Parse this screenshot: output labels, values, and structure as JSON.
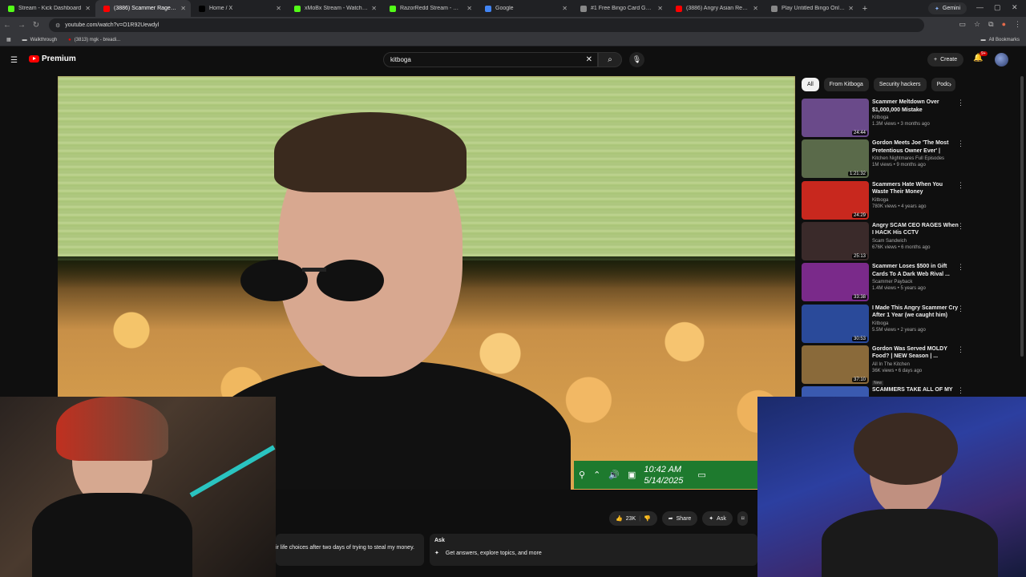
{
  "browser": {
    "tabs": [
      {
        "label": "Stream - Kick Dashboard",
        "color": "#53fc18"
      },
      {
        "label": "(3886) Scammer Rages Lo...",
        "color": "#ff0000"
      },
      {
        "label": "Home / X",
        "color": "#000000"
      },
      {
        "label": "xMoBx Stream - Watch Live on",
        "color": "#53fc18"
      },
      {
        "label": "RazorRedd Stream - Watch Live",
        "color": "#53fc18"
      },
      {
        "label": "Google",
        "color": "#4285f4"
      },
      {
        "label": "#1 Free Bingo Card Generator",
        "color": "#888888"
      },
      {
        "label": "(3886) Angry Asian Restaurant",
        "color": "#ff0000"
      },
      {
        "label": "Play Untitled Bingo Online | Bi",
        "color": "#888888"
      }
    ],
    "gemini_label": "Gemini",
    "url": "youtube.com/watch?v=O1R92Uewdyl",
    "bookmarks": [
      {
        "label": "Walkthrough"
      },
      {
        "label": "(3813) mgk - breadi..."
      }
    ],
    "all_bookmarks": "All Bookmarks"
  },
  "youtube": {
    "logo_text": "Premium",
    "search_value": "kitboga",
    "create_label": "Create",
    "notif_badge": "9+",
    "chips": [
      "All",
      "From Kitboga",
      "Security hackers",
      "Podc"
    ],
    "likes": "23K",
    "share_label": "Share",
    "ask_label": "Ask",
    "description_snippet": "ir life choices after two days of trying to steal my money.",
    "ask_title": "Ask",
    "ask_prompt": "Get answers, explore topics, and more",
    "recommendations": [
      {
        "title": "Scammer Meltdown Over $1,000,000 Mistake",
        "channel": "Kitboga",
        "meta": "1.3M views • 3 months ago",
        "duration": "24:44",
        "thumb_color": "#6a4a8a"
      },
      {
        "title": "Gordon Meets Joe 'The Most Pretentious Owner Ever' | FULL...",
        "channel": "Kitchen Nightmares Full Episodes",
        "meta": "1M views • 9 months ago",
        "duration": "1:21:32",
        "thumb_color": "#5a6a4a"
      },
      {
        "title": "Scammers Hate When You Waste Their Money",
        "channel": "Kitboga",
        "meta": "780K views • 4 years ago",
        "duration": "24:29",
        "thumb_color": "#c8281e"
      },
      {
        "title": "Angry SCAM CEO RAGES When I HACK His CCTV",
        "channel": "Scam Sandwich",
        "meta": "676K views • 6 months ago",
        "duration": "25:13",
        "thumb_color": "#3a2a2a"
      },
      {
        "title": "Scammer Loses $500 in Gift Cards To A Dark Web Rival ...",
        "channel": "Scammer Payback",
        "meta": "1.4M views • 5 years ago",
        "duration": "33:38",
        "thumb_color": "#7a2a8a"
      },
      {
        "title": "I Made This Angry Scammer Cry After 1 Year (we caught him)",
        "channel": "Kitboga",
        "meta": "5.5M views • 2 years ago",
        "duration": "30:53",
        "thumb_color": "#2a4a9a"
      },
      {
        "title": "Gordon Was Served MOLDY Food? | NEW Season | ...",
        "channel": "All In The Kitchen",
        "meta": "36K views • 6 days ago",
        "duration": "37:10",
        "thumb_color": "#8a6a3a",
        "new": "New"
      },
      {
        "title": "SCAMMERS TAKE ALL OF MY",
        "channel": "",
        "meta": "",
        "duration": "",
        "thumb_color": "#3a5ab0"
      }
    ]
  },
  "video_overlay": {
    "time": "10:42 AM",
    "date": "5/14/2025"
  }
}
